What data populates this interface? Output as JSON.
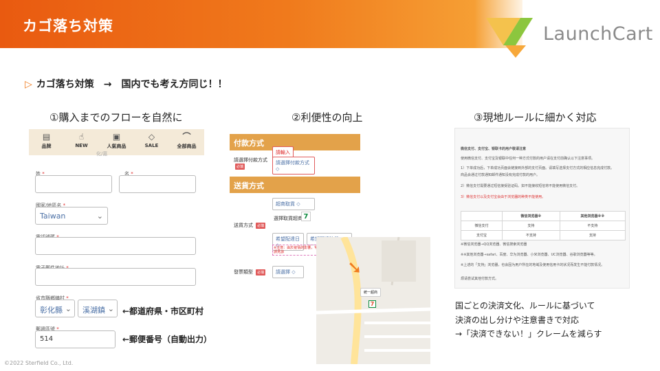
{
  "header": {
    "title": "カゴ落ち対策",
    "logo": "LaunchCart"
  },
  "subtitle": {
    "marker": "▷",
    "text": "カゴ落ち対策　→　国内でも考え方同じ！！"
  },
  "columns": {
    "col1": "①購入までのフローを自然に",
    "col2": "②利便性の向上",
    "col3": "③現地ルールに細かく対応"
  },
  "form": {
    "nav": [
      {
        "icon": "home-icon",
        "label": "品牌"
      },
      {
        "icon": "thumb-icon",
        "label": "NEW"
      },
      {
        "icon": "gift-icon",
        "label": "人氣商品"
      },
      {
        "icon": "tag-icon",
        "label": "SALE"
      },
      {
        "icon": "shoe-icon",
        "label": "全部商品"
      }
    ],
    "nav_sub": "化/嘉",
    "last_name_label": "姓",
    "first_name_label": "名",
    "region_label": "國家/地區名",
    "region_value": "Taiwan",
    "phone_label": "電話號碼",
    "email_label": "電子郵件地址",
    "city_label": "省市縣鄉鎮村",
    "city_value": "彰化縣",
    "town_value": "溪湖鎮",
    "postal_label": "郵遞區號",
    "postal_value": "514",
    "note_city": "←都道府県・市区町村",
    "note_postal": "←郵便番号（自動出力）"
  },
  "payment": {
    "method_header": "付款方式",
    "method_label": "請選擇付款方式",
    "method_input_tag": "請輸入",
    "method_select": "請選擇付款方式",
    "shipping_header": "送貨方式",
    "shipping_label": "送貨方式",
    "shipping_select": "超商取貨",
    "store_label": "選擇取貨超商",
    "date_select": "希望配達日",
    "time_select": "希望配達時段",
    "shipping_note": "※注意：由於疫情的影響，宅配時間可能有延誤，敬請見諒",
    "invoice_label": "發票類型",
    "invoice_select": "請選擇",
    "required_tag": "必填",
    "map_marker": "7",
    "map_store": "統一超商"
  },
  "doc": {
    "lines": [
      {
        "text": "微信支付、支付宝、银联卡的用户敬请注意",
        "red": false
      },
      {
        "text": "使用微信支付、支付宝及银联中任何一种方式付款的用户请在支付前确认以下注意事项。",
        "red": false
      },
      {
        "text": "1）下单成功后，下单成功页面会链接到外部的支付页面。请填写选择支付方式的相应信息完成付款。",
        "red": false
      },
      {
        "text": "商品会通过付款通知邮件通知没有完成付款的用户。",
        "red": false
      },
      {
        "text": "2）微信支付需要通过短信接受验证码。如不能接收短信将不能使用微信支付。",
        "red": false
      },
      {
        "text": "3）微信支付以及支付宝会由于浏览器的种类不能使用。",
        "red": true
      }
    ],
    "table_headers": [
      "",
      "微信浏览器※",
      "其他浏览器※※"
    ],
    "table_rows": [
      [
        "微信支付",
        "支持",
        "不支持"
      ],
      [
        "支付宝",
        "不支持",
        "支持"
      ]
    ],
    "foot": [
      "※微信浏览器→QQ浏览器、微信搜索浏览器",
      "※※其他浏览器→safari、百度、华为浏览器、小米浏览器、UC浏览器、谷歌浏览器等等。",
      "※上述的「支持」浏览器，也会因为用户所在的地域及使用信用卡的状况而发生不能付款情况。",
      "烦请尝试其他付款方式。"
    ]
  },
  "desc": [
    "国ごとの決済文化、ルールに基づいて",
    "決済の出し分けや注意書きで対応",
    "→「決済できない！」クレームを減らす"
  ],
  "copyright": "©2022 Sterfield Co., Ltd.",
  "colors": {
    "accent": "#f07a1c",
    "header_start": "#e95a10",
    "panel_header": "#e3a24a"
  }
}
